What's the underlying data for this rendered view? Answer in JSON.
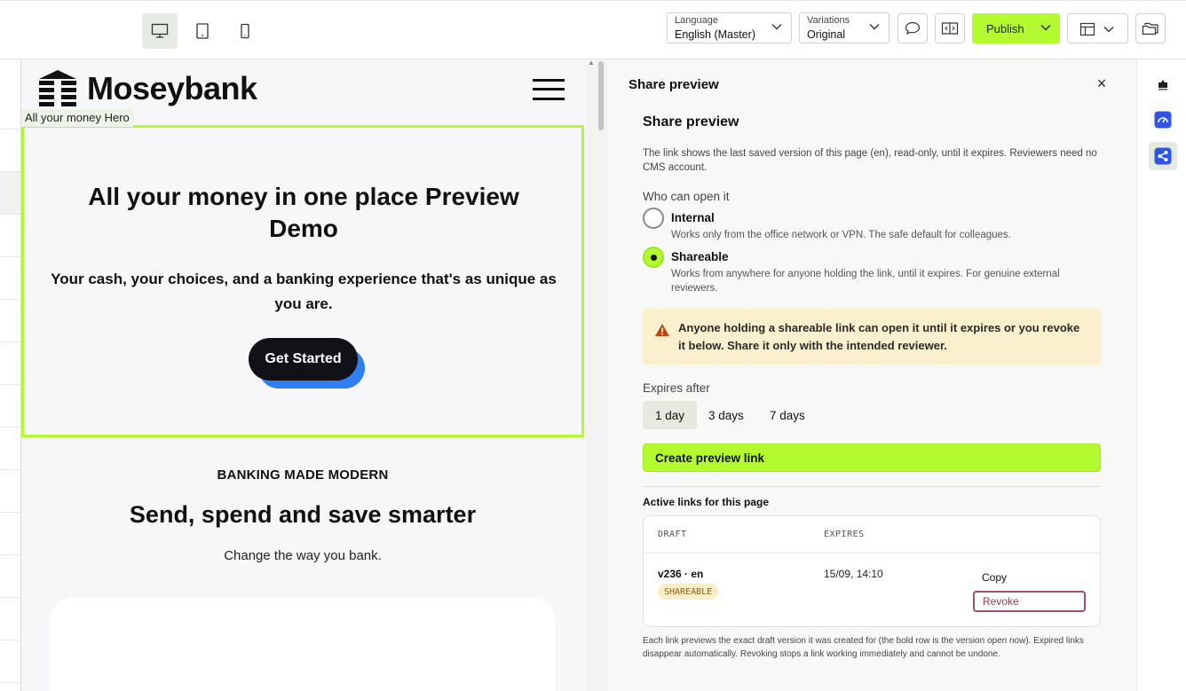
{
  "toolbar": {
    "devices": [
      "desktop-icon",
      "tablet-icon",
      "mobile-icon"
    ],
    "active_device": "desktop",
    "language": {
      "label": "Language",
      "value": "English (Master)"
    },
    "variations": {
      "label": "Variations",
      "value": "Original"
    },
    "publish_label": "Publish",
    "accent": "#b3fb2e"
  },
  "preview": {
    "brand": "Moseybank",
    "hero_tag": "All your money Hero",
    "hero_title": "All your money in one place Preview Demo",
    "hero_subtitle": "Your cash, your choices, and a banking experience that's as unique as you are.",
    "cta_label": "Get Started",
    "eyebrow": "BANKING MADE MODERN",
    "section_title": "Send, spend and save smarter",
    "section_subtitle": "Change the way you bank."
  },
  "share": {
    "header": "Share preview",
    "title": "Share preview",
    "description": "The link shows the last saved version of this page (en), read-only, until it expires. Reviewers need no CMS account.",
    "who_label": "Who can open it",
    "options": [
      {
        "title": "Internal",
        "description": "Works only from the office network or VPN. The safe default for colleagues.",
        "checked": false
      },
      {
        "title": "Shareable",
        "description": "Works from anywhere for anyone holding the link, until it expires. For genuine external reviewers.",
        "checked": true
      }
    ],
    "warning": "Anyone holding a shareable link can open it until it expires or you revoke it below. Share it only with the intended reviewer.",
    "expires_label": "Expires after",
    "expires_options": [
      "1 day",
      "3 days",
      "7 days"
    ],
    "expires_selected": "1 day",
    "create_label": "Create preview link",
    "active_links_label": "Active links for this page",
    "table": {
      "headers": [
        "DRAFT",
        "EXPIRES"
      ],
      "rows": [
        {
          "version": "v236 · en",
          "badge": "SHAREABLE",
          "expires": "15/09, 14:10",
          "copy": "Copy",
          "revoke": "Revoke"
        }
      ]
    },
    "footnote": "Each link previews the exact draft version it was created for (the bold row is the version open now). Expired links disappear automatically. Revoking stops a link working immediately and cannot be undone."
  },
  "rail": {
    "items": [
      "storyblok-logo-icon",
      "speedometer-icon",
      "share-icon"
    ],
    "active": "share-icon"
  }
}
